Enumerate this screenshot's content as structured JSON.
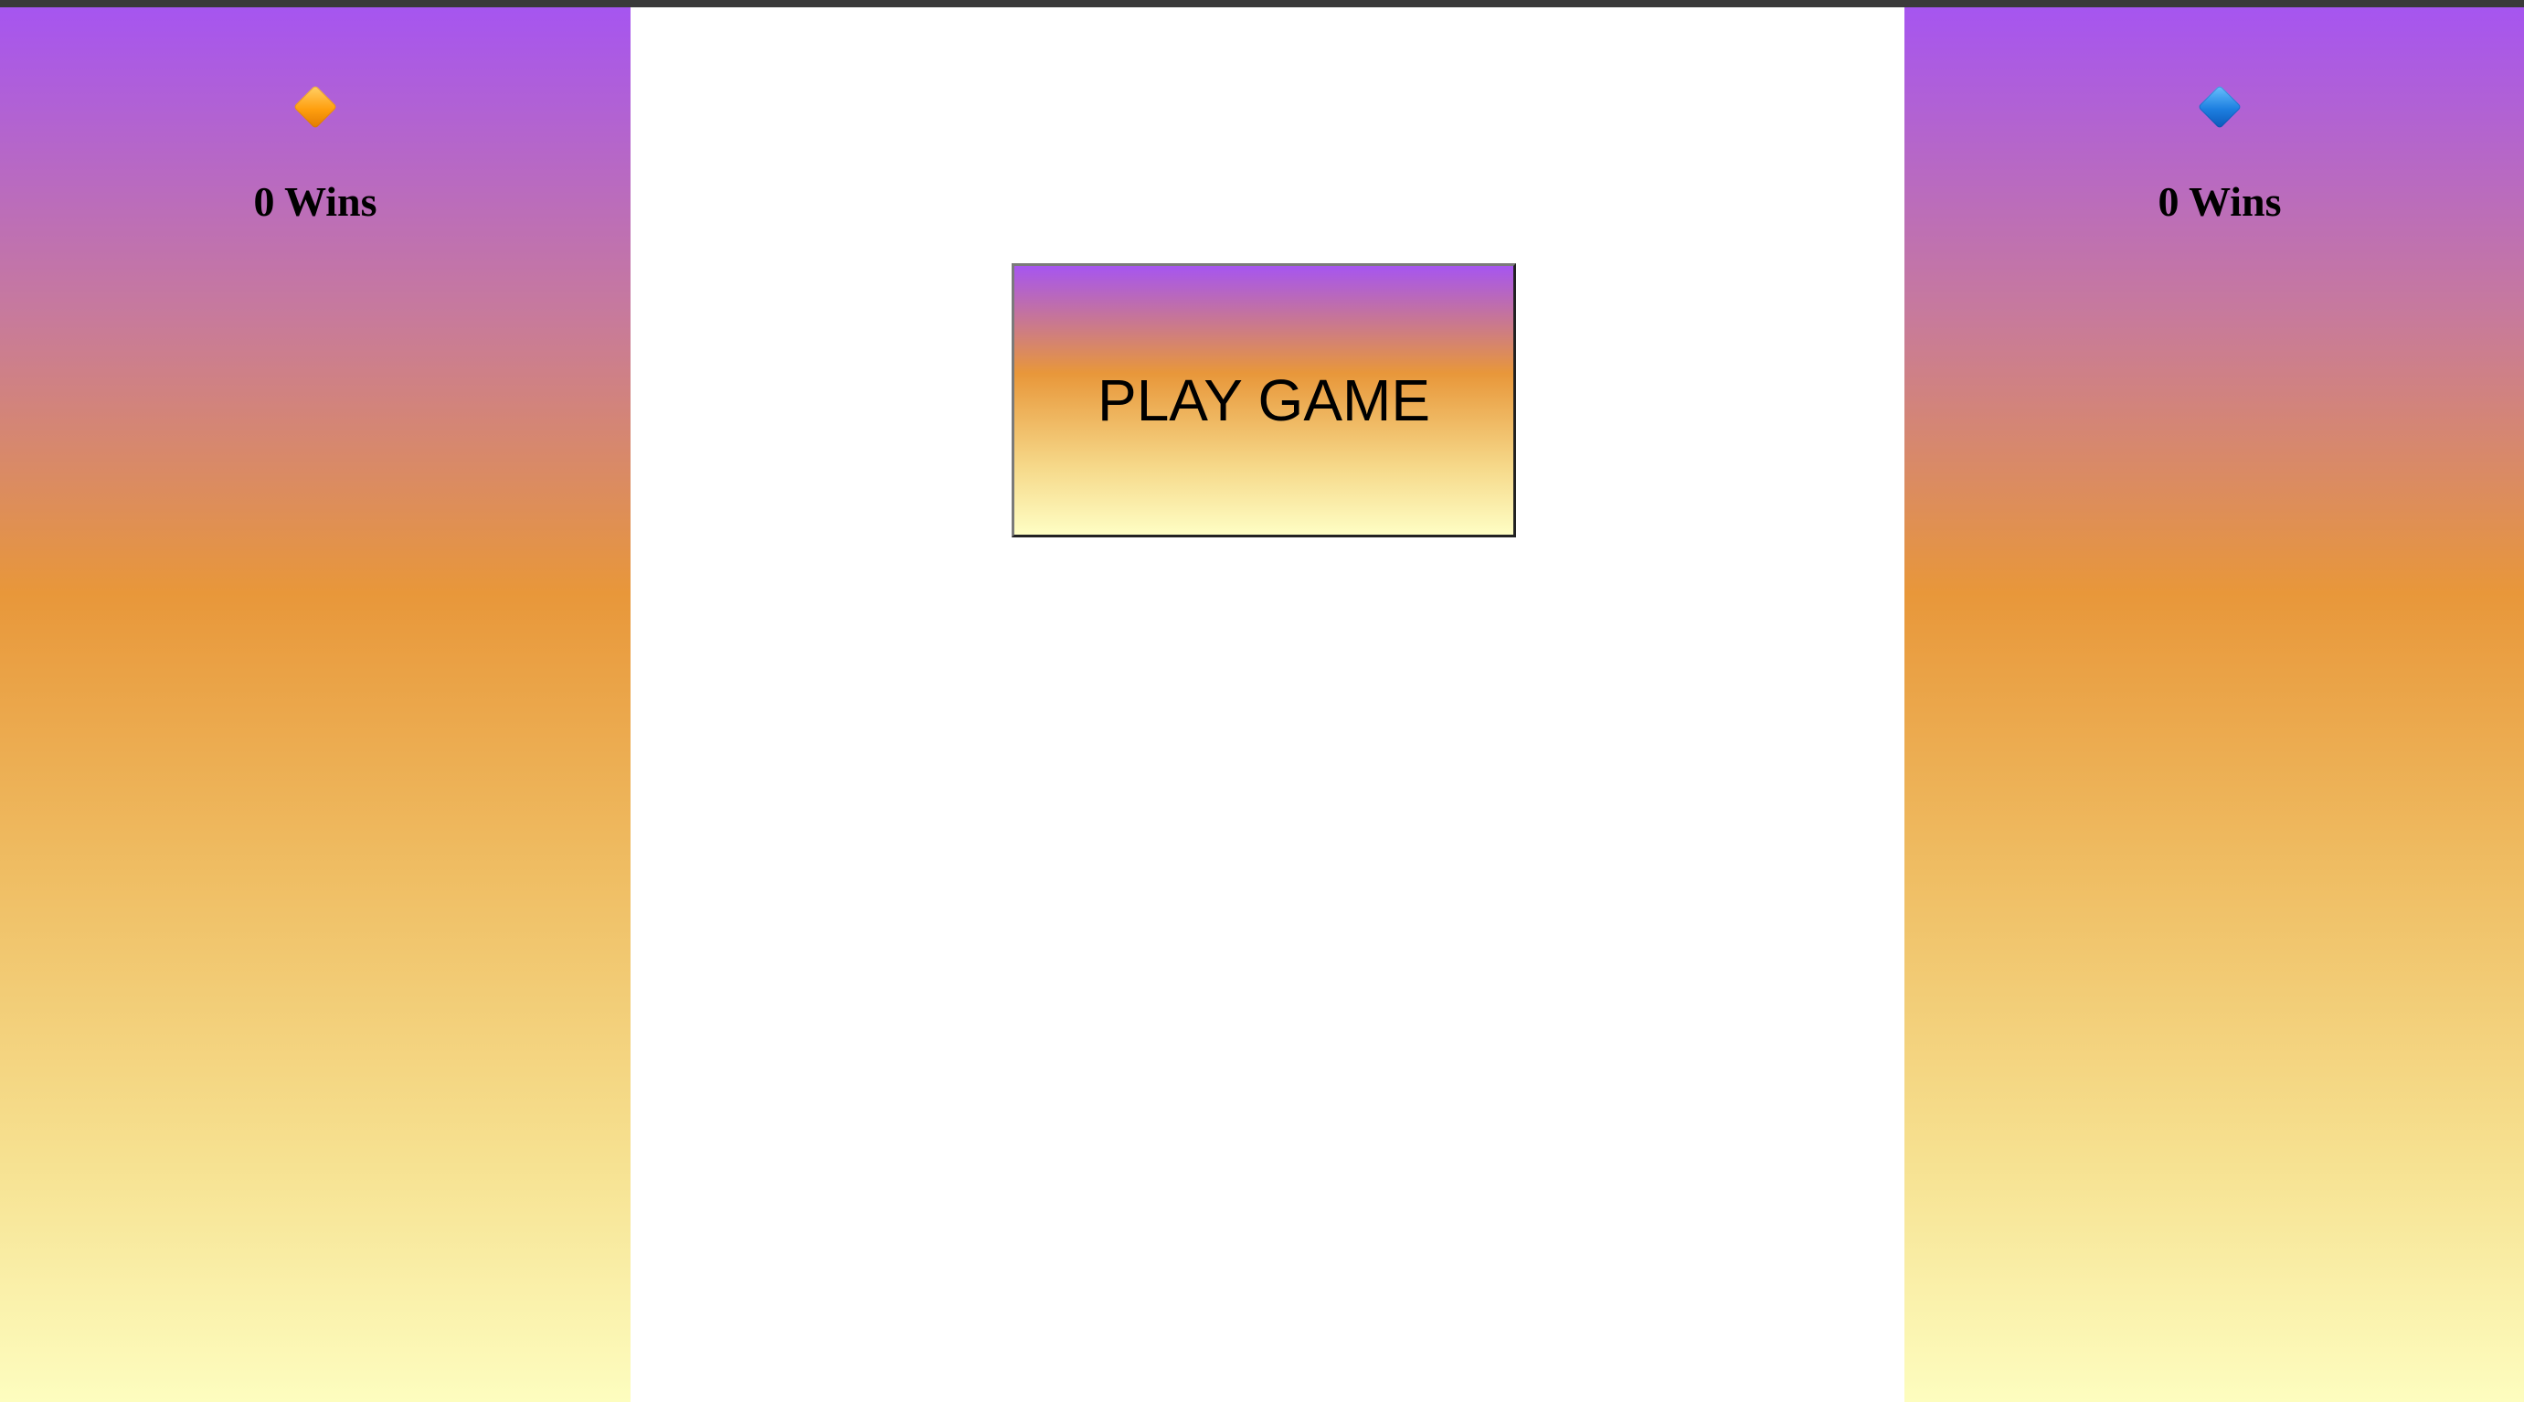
{
  "player_left": {
    "icon": "orange-diamond-icon",
    "wins_label": "0 Wins"
  },
  "player_right": {
    "icon": "blue-diamond-icon",
    "wins_label": "0 Wins"
  },
  "play_button": {
    "label": "PLAY GAME"
  },
  "colors": {
    "gradient_top": "#a655f0",
    "gradient_mid": "#e8973a",
    "gradient_bottom": "#fdfdbf",
    "orange_gem": "#ff9f0f",
    "blue_gem": "#1d7fe0"
  }
}
